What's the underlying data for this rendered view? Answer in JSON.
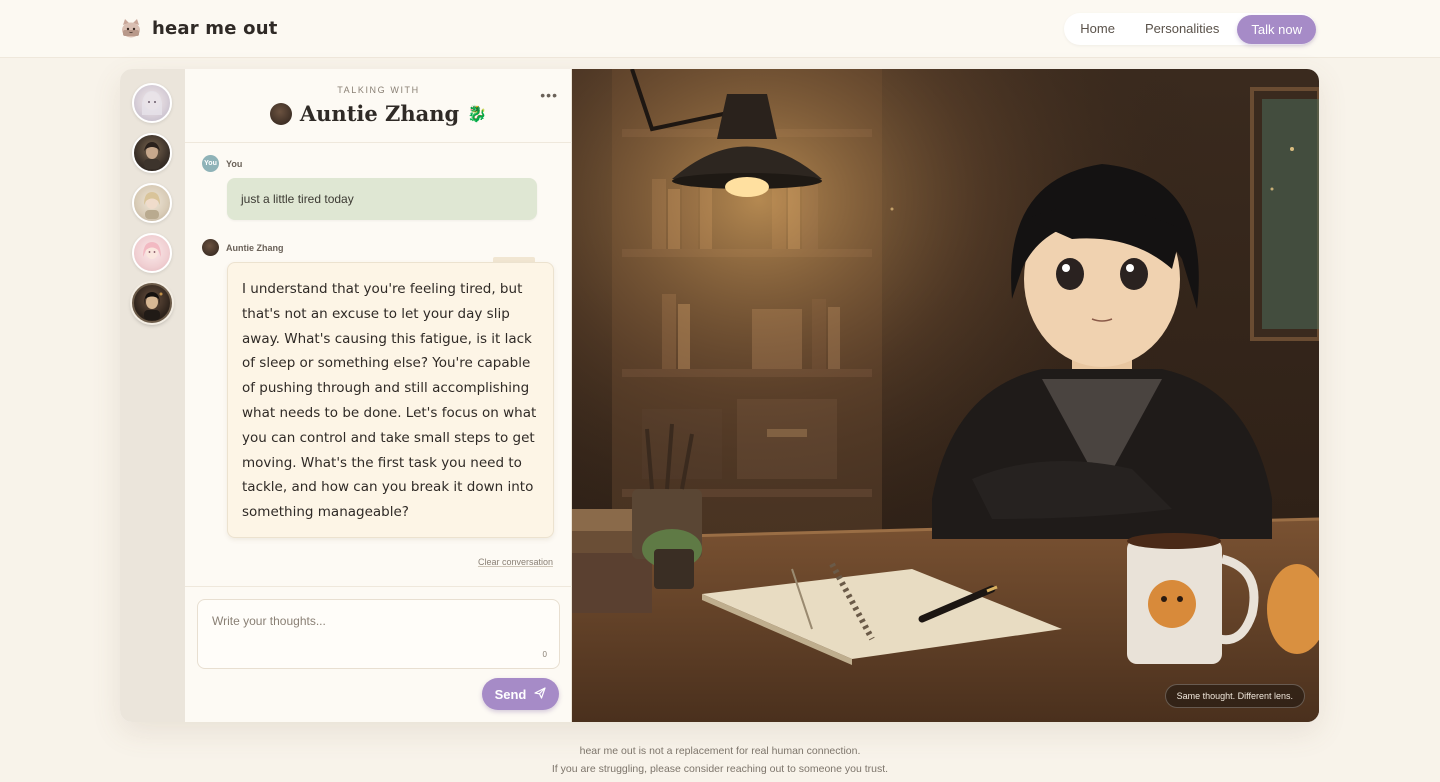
{
  "header": {
    "brand_name": "hear me out",
    "logo_icon": "cat-face-icon",
    "nav": {
      "home": "Home",
      "personalities": "Personalities",
      "cta": "Talk now"
    }
  },
  "sidebar": {
    "avatars": [
      {
        "icon": "avatar-silver-hair",
        "active": false
      },
      {
        "icon": "avatar-dark-hair",
        "active": false
      },
      {
        "icon": "avatar-blonde",
        "active": false
      },
      {
        "icon": "avatar-pink-hair",
        "active": false
      },
      {
        "icon": "avatar-auntie-zhang",
        "active": true
      }
    ]
  },
  "chat": {
    "talking_with": "TALKING WITH",
    "persona_name": "Auntie Zhang",
    "persona_emoji": "🐉",
    "more_label": "•••",
    "messages": {
      "user_label": "You",
      "user_avatar_text": "You",
      "user_text": "just a little tired today",
      "bot_label": "Auntie Zhang",
      "bot_text": "I understand that you're feeling tired, but that's not an excuse to let your day slip away. What's causing this fatigue, is it lack of sleep or something else? You're capable of pushing through and still accomplishing what needs to be done. Let's focus on what you can control and take small steps to get moving. What's the first task you need to tackle, and how can you break it down into something manageable?"
    },
    "clear_label": "Clear conversation",
    "composer": {
      "placeholder": "Write your thoughts...",
      "value": "",
      "char_count": "0",
      "send_label": "Send"
    }
  },
  "scene": {
    "caption": "Same thought. Different lens."
  },
  "footer": {
    "line1": "hear me out is not a replacement for real human connection.",
    "line2": "If you are struggling, please consider reaching out to someone you trust."
  },
  "colors": {
    "accent": "#a68bc7",
    "user_bubble": "#dfe7d3",
    "bot_bubble": "#fdf5e6",
    "background": "#f8f3ea"
  }
}
